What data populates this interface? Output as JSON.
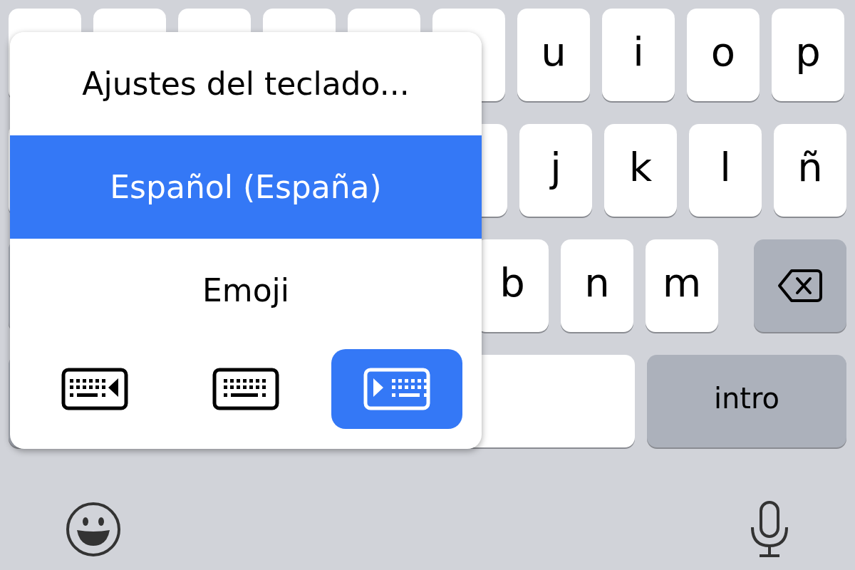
{
  "keyboard": {
    "rows": [
      {
        "keys": [
          {
            "kind": "letter"
          },
          {
            "kind": "letter"
          },
          {
            "kind": "letter"
          },
          {
            "kind": "letter"
          },
          {
            "kind": "letter"
          },
          {
            "kind": "letter"
          },
          {
            "kind": "letter",
            "label": "u"
          },
          {
            "kind": "letter",
            "label": "i"
          },
          {
            "kind": "letter",
            "label": "o"
          },
          {
            "kind": "letter",
            "label": "p"
          }
        ]
      },
      {
        "keys": [
          {
            "kind": "letter"
          },
          {
            "kind": "letter"
          },
          {
            "kind": "letter",
            "label": "j"
          },
          {
            "kind": "letter",
            "label": "k"
          },
          {
            "kind": "letter",
            "label": "l"
          },
          {
            "kind": "letter",
            "label": "ñ"
          }
        ]
      },
      {
        "keys": [
          {
            "kind": "shift"
          },
          {
            "kind": "letter"
          },
          {
            "kind": "letter"
          },
          {
            "kind": "letter"
          },
          {
            "kind": "letter"
          },
          {
            "kind": "letter",
            "label": "b"
          },
          {
            "kind": "letter",
            "label": "n"
          },
          {
            "kind": "letter",
            "label": "m"
          },
          {
            "kind": "delete"
          }
        ]
      },
      {
        "keys": [
          {
            "kind": "function"
          },
          {
            "kind": "function"
          },
          {
            "kind": "space"
          },
          {
            "kind": "return",
            "label": "intro"
          }
        ]
      }
    ]
  },
  "popup": {
    "items": [
      {
        "label": "Ajustes del teclado...",
        "selected": false
      },
      {
        "label": "Español (España)",
        "selected": true
      },
      {
        "label": "Emoji",
        "selected": false
      }
    ],
    "layouts": [
      {
        "kind": "left",
        "selected": false
      },
      {
        "kind": "full",
        "selected": false
      },
      {
        "kind": "right",
        "selected": true
      }
    ]
  }
}
